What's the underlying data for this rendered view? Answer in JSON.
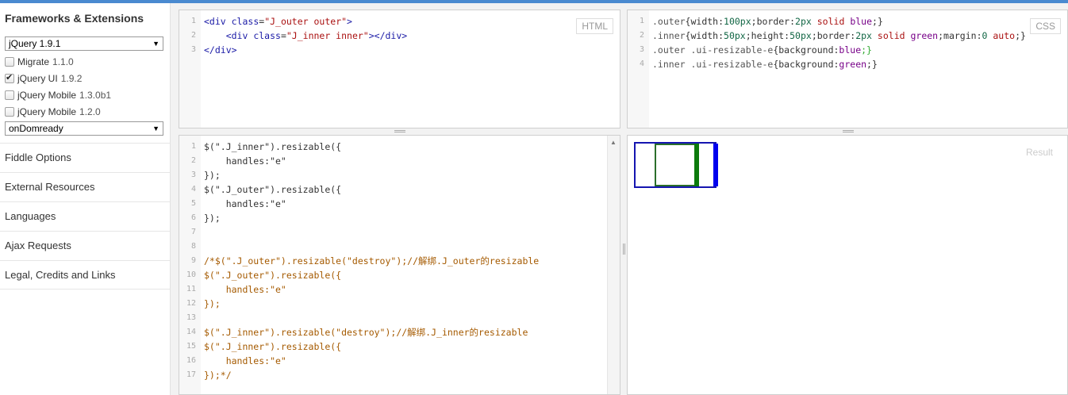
{
  "sidebar": {
    "heading": "Frameworks & Extensions",
    "framework_select": "jQuery 1.9.1",
    "extensions": [
      {
        "name": "Migrate",
        "version": "1.1.0",
        "checked": false
      },
      {
        "name": "jQuery UI",
        "version": "1.9.2",
        "checked": true
      },
      {
        "name": "jQuery Mobile",
        "version": "1.3.0b1",
        "checked": false
      },
      {
        "name": "jQuery Mobile",
        "version": "1.2.0",
        "checked": false
      }
    ],
    "load_select": "onDomready",
    "sections": [
      "Fiddle Options",
      "External Resources",
      "Languages",
      "Ajax Requests",
      "Legal, Credits and Links"
    ]
  },
  "panels": {
    "html_label": "HTML",
    "css_label": "CSS",
    "result_label": "Result"
  },
  "html_code": {
    "line_numbers": [
      "1",
      "2",
      "3"
    ],
    "l1_a": "<div ",
    "l1_b": "class",
    "l1_c": "=",
    "l1_d": "\"J_outer outer\"",
    "l1_e": ">",
    "l2_a": "    <div ",
    "l2_b": "class",
    "l2_c": "=",
    "l2_d": "\"J_inner inner\"",
    "l2_e": "></div>",
    "l3_a": "</div>"
  },
  "css_code": {
    "line_numbers": [
      "1",
      "2",
      "3",
      "4"
    ],
    "l1_sel": ".outer",
    "l1_a": "{width:",
    "l1_n1": "100px",
    "l1_b": ";border:",
    "l1_n2": "2px",
    "l1_c": " ",
    "l1_kw": "solid",
    "l1_d": " ",
    "l1_col": "blue",
    "l1_e": ";}",
    "l2_sel": ".inner",
    "l2_a": "{width:",
    "l2_n1": "50px",
    "l2_b": ";height:",
    "l2_n2": "50px",
    "l2_c": ";border:",
    "l2_n3": "2px",
    "l2_d": " ",
    "l2_kw": "solid",
    "l2_e": " ",
    "l2_col": "green",
    "l2_f": ";margin:",
    "l2_n4": "0",
    "l2_g": " ",
    "l2_auto": "auto",
    "l2_h": ";}",
    "l3_sel": ".outer .ui-resizable-e",
    "l3_a": "{background:",
    "l3_col": "blue",
    "l3_b": ";}",
    "l4_sel": ".inner .ui-resizable-e",
    "l4_a": "{background:",
    "l4_col": "green",
    "l4_b": ";}"
  },
  "js_code": {
    "line_numbers": [
      "1",
      "2",
      "3",
      "4",
      "5",
      "6",
      "7",
      "8",
      "9",
      "10",
      "11",
      "12",
      "13",
      "14",
      "15",
      "16",
      "17"
    ],
    "lines": [
      "$(\".J_inner\").resizable({",
      "    handles:\"e\"",
      "});",
      "$(\".J_outer\").resizable({",
      "    handles:\"e\"",
      "});",
      "",
      "",
      "/*$(\".J_outer\").resizable(\"destroy\");//解绑.J_outer的resizable",
      "$(\".J_outer\").resizable({",
      "    handles:\"e\"",
      "});",
      "",
      "$(\".J_inner\").resizable(\"destroy\");//解绑.J_inner的resizable",
      "$(\".J_inner\").resizable({",
      "    handles:\"e\"",
      "});*/"
    ]
  },
  "colors": {
    "topbar": "#4a8ad0",
    "outer_border": "#1515b0",
    "inner_border": "#2b6e2b",
    "handle_blue": "#0000ee",
    "handle_green": "#0c7a0c"
  }
}
